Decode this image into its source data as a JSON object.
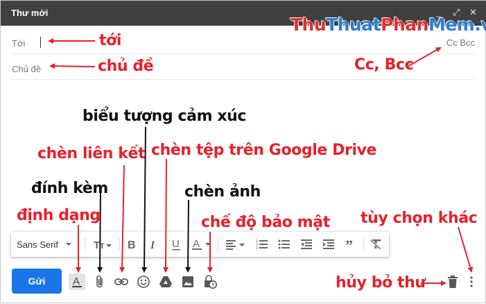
{
  "window": {
    "title": "Thư mới",
    "controls": [
      "_",
      "⤢",
      "✕"
    ]
  },
  "watermark": {
    "part1": "Thu",
    "part2": "Thuat",
    "part3": "Phan",
    "part4": "Mem",
    "part5": ".vn"
  },
  "fields": {
    "to_label": "Tới",
    "subject_label": "Chủ đề",
    "cc_bcc": "Cc Bcc"
  },
  "formatting": {
    "font": "Sans Serif"
  },
  "send_label": "Gửi",
  "annotations": {
    "to": "tới",
    "subject": "chủ đề",
    "ccbcc": "Cc, Bcc",
    "emoji": "biểu tượng cảm xúc",
    "link": "chèn liên kết",
    "drive": "chèn tệp trên Google Drive",
    "attach": "đính kèm",
    "photo": "chèn ảnh",
    "format": "định dạng",
    "confidential": "chế độ bảo mật",
    "more": "tùy chọn khác",
    "discard": "hủy bỏ thư"
  },
  "colors": {
    "titlebar": "#404040",
    "send_button": "#1a73e8",
    "annotation_red": "#e8202a",
    "annotation_black": "#111111"
  },
  "icons": [
    "format-text-icon",
    "attach-icon",
    "link-icon",
    "emoji-icon",
    "drive-icon",
    "photo-icon",
    "confidential-icon",
    "trash-icon",
    "more-options-icon"
  ]
}
